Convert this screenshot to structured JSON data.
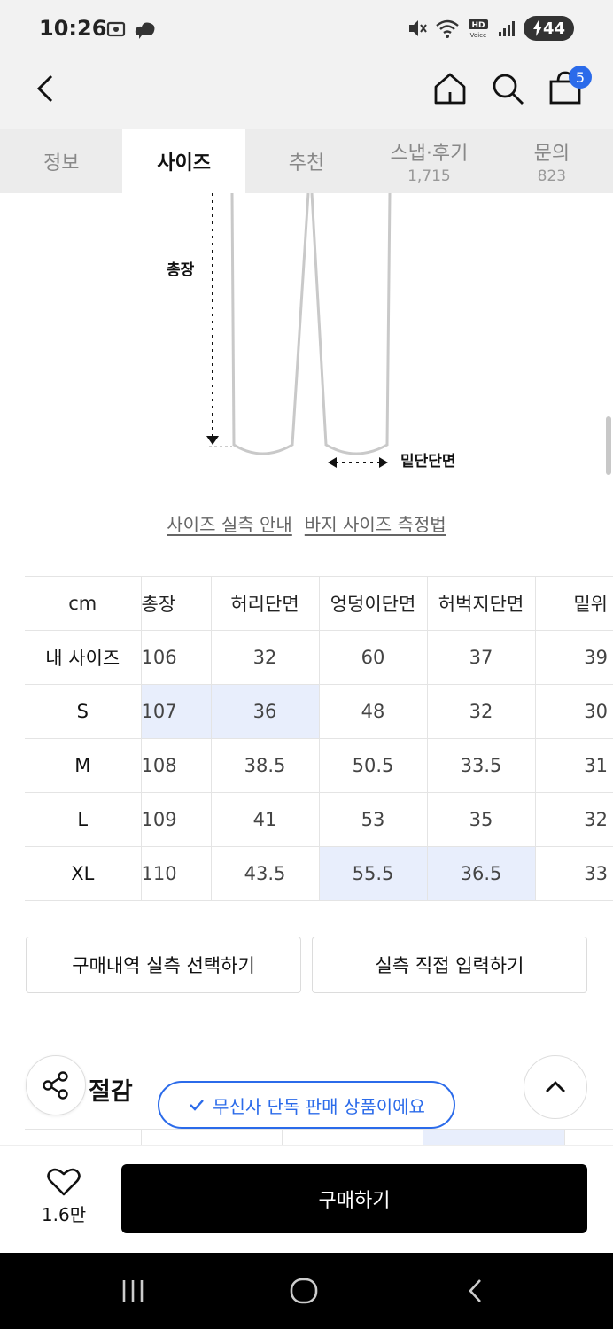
{
  "status_bar": {
    "time": "10:26",
    "battery": "44",
    "icons": [
      "screenshot-icon",
      "cloud-app-icon",
      "mute-icon",
      "wifi-icon",
      "hd-voice-icon",
      "signal-icon"
    ]
  },
  "header": {
    "cart_count": "5"
  },
  "tabs": [
    {
      "label": "정보",
      "count": ""
    },
    {
      "label": "사이즈",
      "count": ""
    },
    {
      "label": "추천",
      "count": ""
    },
    {
      "label": "스냅·후기",
      "count": "1,715"
    },
    {
      "label": "문의",
      "count": "823"
    }
  ],
  "diagram": {
    "total_length_label": "총장",
    "hem_label": "밑단단면"
  },
  "guide_links": {
    "size_guide": "사이즈 실측 안내",
    "measure_guide": "바지 사이즈 측정법"
  },
  "size_table": {
    "headers": [
      "cm",
      "총장",
      "허리단면",
      "엉덩이단면",
      "허벅지단면",
      "밑위"
    ],
    "rows": [
      {
        "label": "내 사이즈",
        "values": [
          "106",
          "32",
          "60",
          "37",
          "39"
        ]
      },
      {
        "label": "S",
        "values": [
          "107",
          "36",
          "48",
          "32",
          "30"
        ]
      },
      {
        "label": "M",
        "values": [
          "108",
          "38.5",
          "50.5",
          "33.5",
          "31"
        ]
      },
      {
        "label": "L",
        "values": [
          "109",
          "41",
          "53",
          "35",
          "32"
        ]
      },
      {
        "label": "XL",
        "values": [
          "110",
          "43.5",
          "55.5",
          "36.5",
          "33"
        ]
      }
    ]
  },
  "actions": {
    "purchase_history": "구매내역 실측 선택하기",
    "manual_input": "실측 직접 입력하기"
  },
  "section": {
    "heading": "절감"
  },
  "exclusive_badge": "무신사 단독 판매 상품이에요",
  "bottom_bar": {
    "like_count": "1.6만",
    "buy_label": "구매하기"
  },
  "colors": {
    "accent": "#2b6bea",
    "highlight": "#e8eefc",
    "header_bg": "#f2f2f2"
  }
}
